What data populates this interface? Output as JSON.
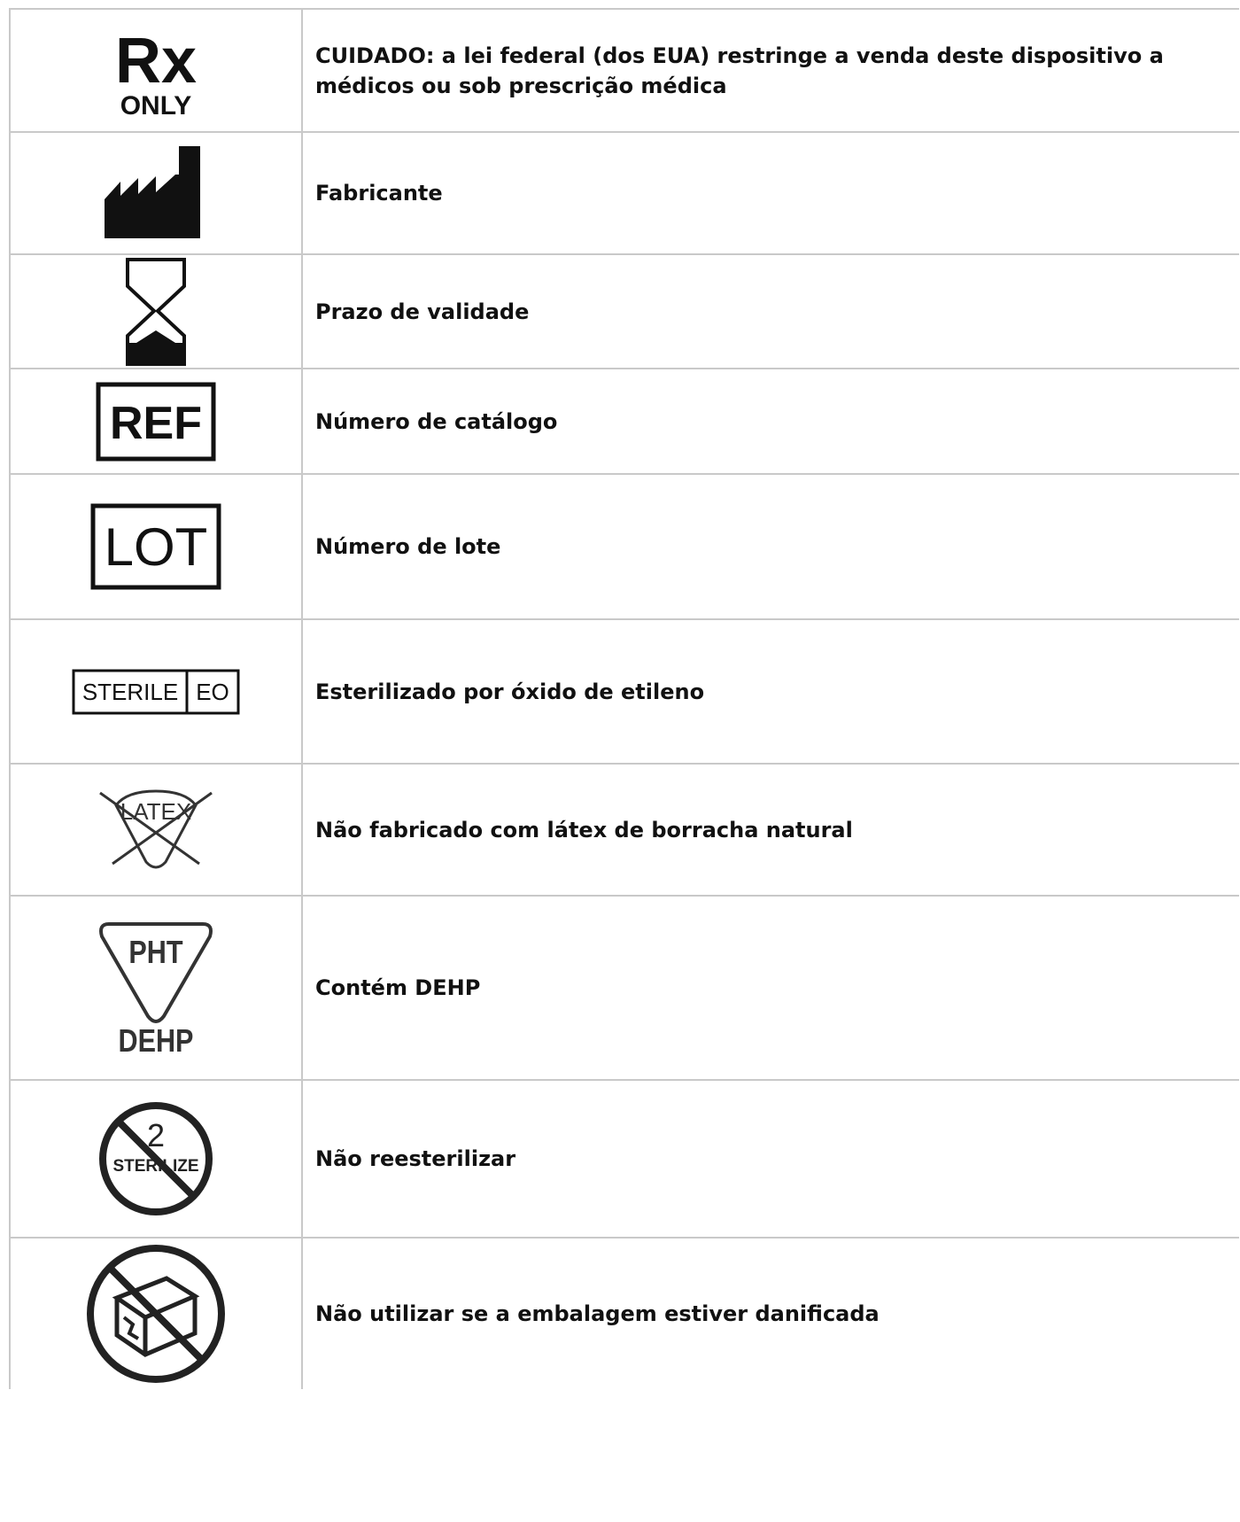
{
  "rows": [
    {
      "icon": "rx-only-icon",
      "symbol_text": {
        "rx": "Rx",
        "only": "ONLY"
      },
      "label": "CUIDADO: a lei federal (dos EUA) restringe a venda deste dispositivo a médicos ou sob prescrição médica"
    },
    {
      "icon": "manufacturer-icon",
      "label": "Fabricante"
    },
    {
      "icon": "hourglass-icon",
      "label": "Prazo de validade"
    },
    {
      "icon": "ref-icon",
      "symbol_text": "REF",
      "label": "Número de catálogo"
    },
    {
      "icon": "lot-icon",
      "symbol_text": "LOT",
      "label": "Número de lote"
    },
    {
      "icon": "sterile-eo-icon",
      "symbol_text": {
        "sterile": "STERILE",
        "eo": "EO"
      },
      "label": "Esterilizado por óxido de etileno"
    },
    {
      "icon": "no-latex-icon",
      "symbol_text": "LATEX",
      "label": "Não fabricado com látex de borracha natural"
    },
    {
      "icon": "dehp-icon",
      "symbol_text": {
        "pht": "PHT",
        "dehp": "DEHP"
      },
      "label": "Contém DEHP"
    },
    {
      "icon": "do-not-resterilize-icon",
      "symbol_text": {
        "digit": "2",
        "sterilize": "STERILIZE"
      },
      "label": "Não reesterilizar"
    },
    {
      "icon": "do-not-use-if-damaged-icon",
      "label": "Não utilizar se a embalagem estiver danificada"
    }
  ]
}
